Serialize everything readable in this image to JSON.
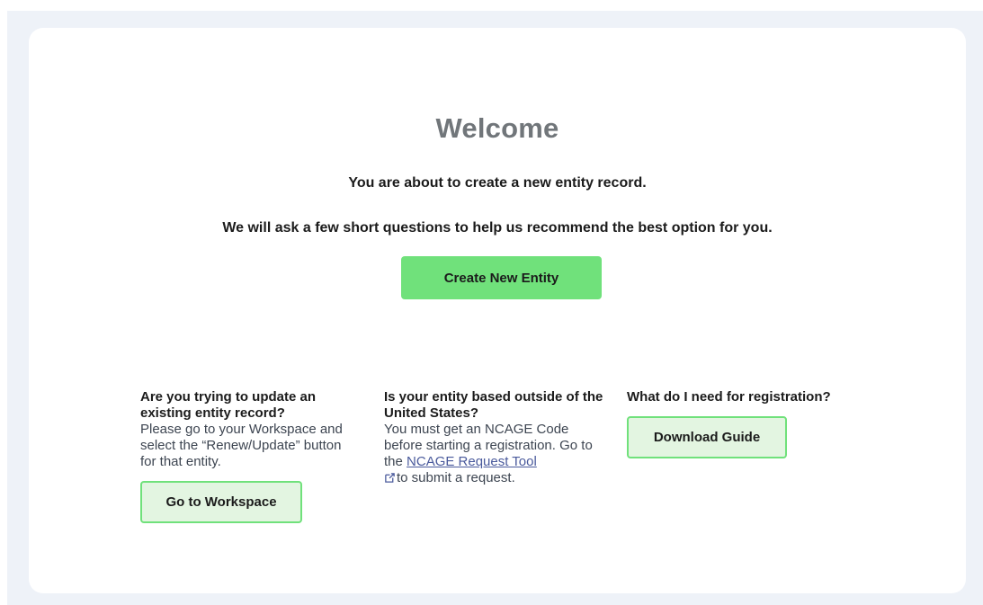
{
  "welcome": {
    "title": "Welcome",
    "line1": "You are about to create a new entity record.",
    "line2": "We will ask a few short questions to help us recommend the best option for you.",
    "create_button": "Create New Entity"
  },
  "update_section": {
    "heading": "Are you trying to update an existing entity record?",
    "text": "Please go to your Workspace and select the “Renew/Update” button for that entity.",
    "button": "Go to Workspace"
  },
  "ncage_section": {
    "heading": "Is your entity based outside of the United States?",
    "text_before": "You must get an NCAGE Code before starting a registration. Go to the ",
    "link": "NCAGE Request Tool",
    "text_after": "to submit a request.",
    "icon": "external-link-icon"
  },
  "guide_section": {
    "heading": "What do I need for registration?",
    "button": "Download Guide"
  },
  "colors": {
    "primary_green": "#70e17b",
    "light_green": "#e3f5e1",
    "title_gray": "#71767a",
    "link_blue": "#4a5a9c",
    "page_bg": "#eef2f8"
  }
}
